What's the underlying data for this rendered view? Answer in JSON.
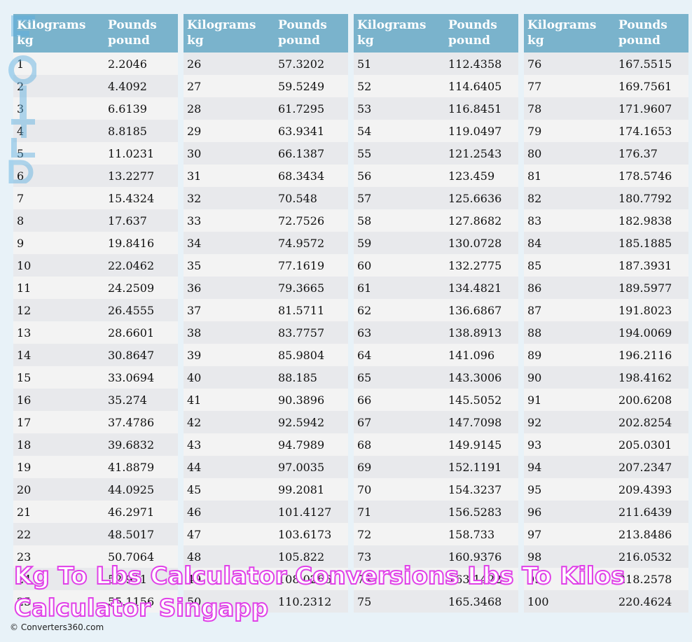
{
  "header": {
    "kg_label": "Kilograms",
    "kg_unit": "kg",
    "lb_label": "Pounds",
    "lb_unit": "pound"
  },
  "tables": [
    {
      "kg": [
        "1",
        "2",
        "3",
        "4",
        "5",
        "6",
        "7",
        "8",
        "9",
        "10",
        "11",
        "12",
        "13",
        "14",
        "15",
        "16",
        "17",
        "18",
        "19",
        "20",
        "21",
        "22",
        "23",
        "24",
        "25"
      ],
      "lb": [
        "2.2046",
        "4.4092",
        "6.6139",
        "8.8185",
        "11.0231",
        "13.2277",
        "15.4324",
        "17.637",
        "19.8416",
        "22.0462",
        "24.2509",
        "26.4555",
        "28.6601",
        "30.8647",
        "33.0694",
        "35.274",
        "37.4786",
        "39.6832",
        "41.8879",
        "44.0925",
        "46.2971",
        "48.5017",
        "50.7064",
        "52.911",
        "55.1156"
      ]
    },
    {
      "kg": [
        "26",
        "27",
        "28",
        "29",
        "30",
        "31",
        "32",
        "33",
        "34",
        "35",
        "36",
        "37",
        "38",
        "39",
        "40",
        "41",
        "42",
        "43",
        "44",
        "45",
        "46",
        "47",
        "48",
        "49",
        "50"
      ],
      "lb": [
        "57.3202",
        "59.5249",
        "61.7295",
        "63.9341",
        "66.1387",
        "68.3434",
        "70.548",
        "72.7526",
        "74.9572",
        "77.1619",
        "79.3665",
        "81.5711",
        "83.7757",
        "85.9804",
        "88.185",
        "90.3896",
        "92.5942",
        "94.7989",
        "97.0035",
        "99.2081",
        "101.4127",
        "103.6173",
        "105.822",
        "108.0266",
        "110.2312"
      ]
    },
    {
      "kg": [
        "51",
        "52",
        "53",
        "54",
        "55",
        "56",
        "57",
        "58",
        "59",
        "60",
        "61",
        "62",
        "63",
        "64",
        "65",
        "66",
        "67",
        "68",
        "69",
        "70",
        "71",
        "72",
        "73",
        "74",
        "75"
      ],
      "lb": [
        "112.4358",
        "114.6405",
        "116.8451",
        "119.0497",
        "121.2543",
        "123.459",
        "125.6636",
        "127.8682",
        "130.0728",
        "132.2775",
        "134.4821",
        "136.6867",
        "138.8913",
        "141.096",
        "143.3006",
        "145.5052",
        "147.7098",
        "149.9145",
        "152.1191",
        "154.3237",
        "156.5283",
        "158.733",
        "160.9376",
        "163.1422",
        "165.3468"
      ]
    },
    {
      "kg": [
        "76",
        "77",
        "78",
        "79",
        "80",
        "81",
        "82",
        "83",
        "84",
        "85",
        "86",
        "87",
        "88",
        "89",
        "90",
        "91",
        "92",
        "93",
        "94",
        "95",
        "96",
        "97",
        "98",
        "99",
        "100"
      ],
      "lb": [
        "167.5515",
        "169.7561",
        "171.9607",
        "174.1653",
        "176.37",
        "178.5746",
        "180.7792",
        "182.9838",
        "185.1885",
        "187.3931",
        "189.5977",
        "191.8023",
        "194.0069",
        "196.2116",
        "198.4162",
        "200.6208",
        "202.8254",
        "205.0301",
        "207.2347",
        "209.4393",
        "211.6439",
        "213.8486",
        "216.0532",
        "218.2578",
        "220.4624"
      ]
    }
  ],
  "overlay_title": "Kg To Lbs Calculator Conversions Lbs To Kilos Calculator Singapp",
  "footer": "© Converters360.com",
  "colors": {
    "header_bg": "#7ab3cc",
    "row_light": "#f3f3f3",
    "row_dark": "#e8e9ec",
    "page_bg": "#e8f2f8",
    "overlay_stroke": "#e040e8"
  }
}
